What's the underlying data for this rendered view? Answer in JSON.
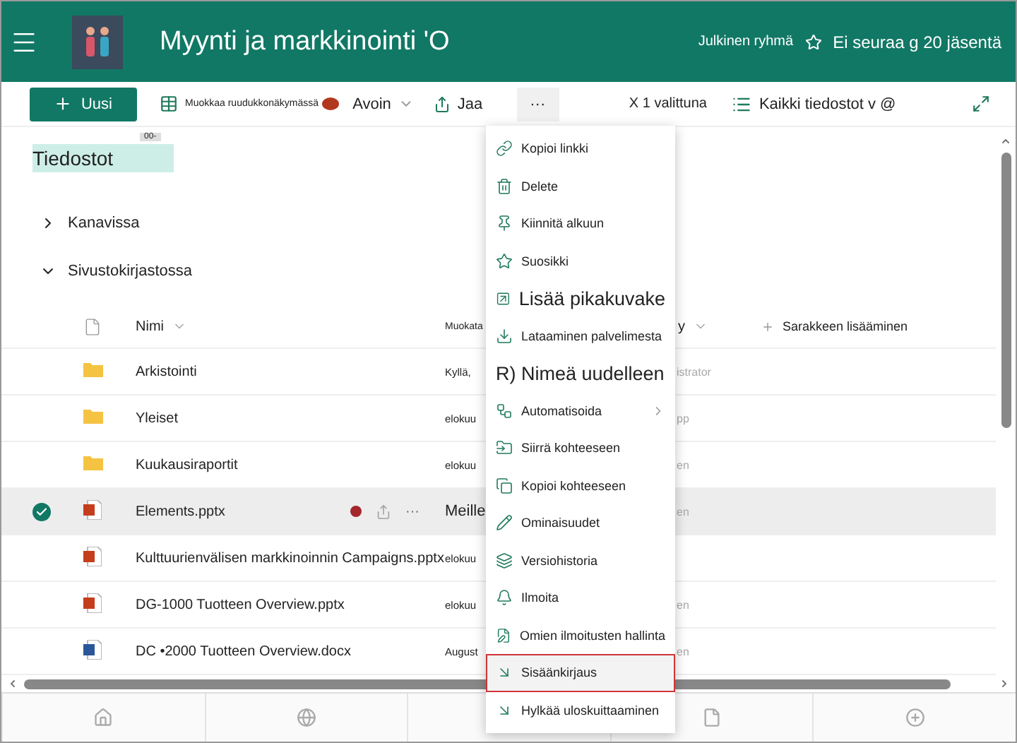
{
  "header": {
    "title": "Myynti ja markkinointi 'O",
    "privacy": "Julkinen ryhmä",
    "follow": "Ei seuraa g 20 jäsentä"
  },
  "toolbar": {
    "new_button": "Uusi",
    "grid_edit": "Muokkaa ruudukkonäkymässä",
    "open": "Avoin",
    "share": "Jaa",
    "more": "···",
    "more_pressed": true,
    "selection": "X 1 valittuna",
    "view": "Kaikki tiedostot v @"
  },
  "page_title": "Tiedostot",
  "title_tag": "00-",
  "sections": [
    {
      "label": "Kanavissa",
      "expanded": false
    },
    {
      "label": "Sivustokirjastossa",
      "expanded": true
    }
  ],
  "table": {
    "columns": {
      "name": "Nimi",
      "modified": "Muokata",
      "modified_by": "y",
      "add_column": "Sarakkeen lisääminen"
    },
    "rows": [
      {
        "kind": "folder",
        "name": "Arkistointi",
        "modified": "Kyllä,",
        "modified_by": "istrator",
        "selected": false
      },
      {
        "kind": "folder",
        "name": "Yleiset",
        "modified": "elokuu",
        "modified_by": "pp",
        "selected": false
      },
      {
        "kind": "folder",
        "name": "Kuukausiraportit",
        "modified": "elokuu",
        "modified_by": "en",
        "selected": false
      },
      {
        "kind": "pptx",
        "name": "Elements.pptx",
        "modified": "Meille",
        "modified_by": "en",
        "selected": true,
        "actions": "···"
      },
      {
        "kind": "pptx",
        "name": "Kulttuurienvälisen markkinoinnin Campaigns.pptx",
        "modified": "elokuu",
        "selected": false
      },
      {
        "kind": "pptx",
        "name": "DG-1000 Tuotteen Overview.pptx",
        "modified": "elokuu",
        "modified_by": "en",
        "selected": false
      },
      {
        "kind": "docx",
        "name": "DC •2000 Tuotteen Overview.docx",
        "modified": "August",
        "modified_by": "en",
        "selected": false
      }
    ]
  },
  "menu": [
    {
      "kind": "link",
      "label": "Kopioi linkki",
      "selected": false
    },
    {
      "kind": "trash",
      "label": "Delete",
      "selected": false
    },
    {
      "kind": "pin",
      "label": "Kiinnitä alkuun",
      "selected": false
    },
    {
      "kind": "star",
      "label": "Suosikki",
      "selected": false
    },
    {
      "kind": "shortcut",
      "label": "Lisää pikakuvake",
      "selected": false
    },
    {
      "kind": "download",
      "label": "Lataaminen palvelimesta",
      "selected": false
    },
    {
      "kind": "rename",
      "label": "R) Nimeä uudelleen",
      "selected": false
    },
    {
      "kind": "flow",
      "label": "Automatisoida",
      "selected": false
    },
    {
      "kind": "move",
      "label": "Siirrä kohteeseen",
      "selected": false
    },
    {
      "kind": "copy",
      "label": "Kopioi kohteeseen",
      "selected": false
    },
    {
      "kind": "pencil",
      "label": "Ominaisuudet",
      "selected": false
    },
    {
      "kind": "versions",
      "label": "Versiohistoria",
      "selected": false
    },
    {
      "kind": "bell",
      "label": "Ilmoita",
      "selected": false
    },
    {
      "kind": "alerts",
      "label": "Omien ilmoitusten hallinta",
      "selected": false
    },
    {
      "kind": "arrow",
      "label": "Sisäänkirjaus",
      "selected": true
    },
    {
      "kind": "arrow",
      "label": "Hylkää uloskuittaaminen",
      "selected": false
    }
  ]
}
